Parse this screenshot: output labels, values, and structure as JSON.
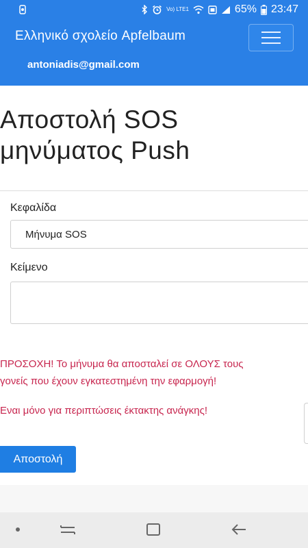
{
  "status_bar": {
    "network_label": "Vo) LTE1",
    "battery_percent": "65%",
    "time": "23:47"
  },
  "header": {
    "app_title": "Ελληνικό σχολείο Apfelbaum",
    "user_email": "antoniadis@gmail.com"
  },
  "page": {
    "title_line1": "Αποστολή SOS",
    "title_line2": "μηνύματος Push"
  },
  "form": {
    "header_label": "Κεφαλίδα",
    "header_value": "Μήνυμα SOS",
    "body_label": "Κείμενο",
    "body_value": ""
  },
  "warnings": {
    "line1": "ΠΡΟΣΟΧΗ! Το μήνυμα θα αποσταλεί σε ΟΛΟΥΣ τους",
    "line2": "γονείς που έχουν εγκατεστημένη την εφαρμογή!",
    "line3": "Εναι μόνο για περιπτώσεις έκτακτης ανάγκης!"
  },
  "actions": {
    "send_label": "Αποστολή"
  },
  "colors": {
    "brand": "#2a80e6",
    "warning": "#c7254e",
    "button": "#1f7ee3"
  }
}
